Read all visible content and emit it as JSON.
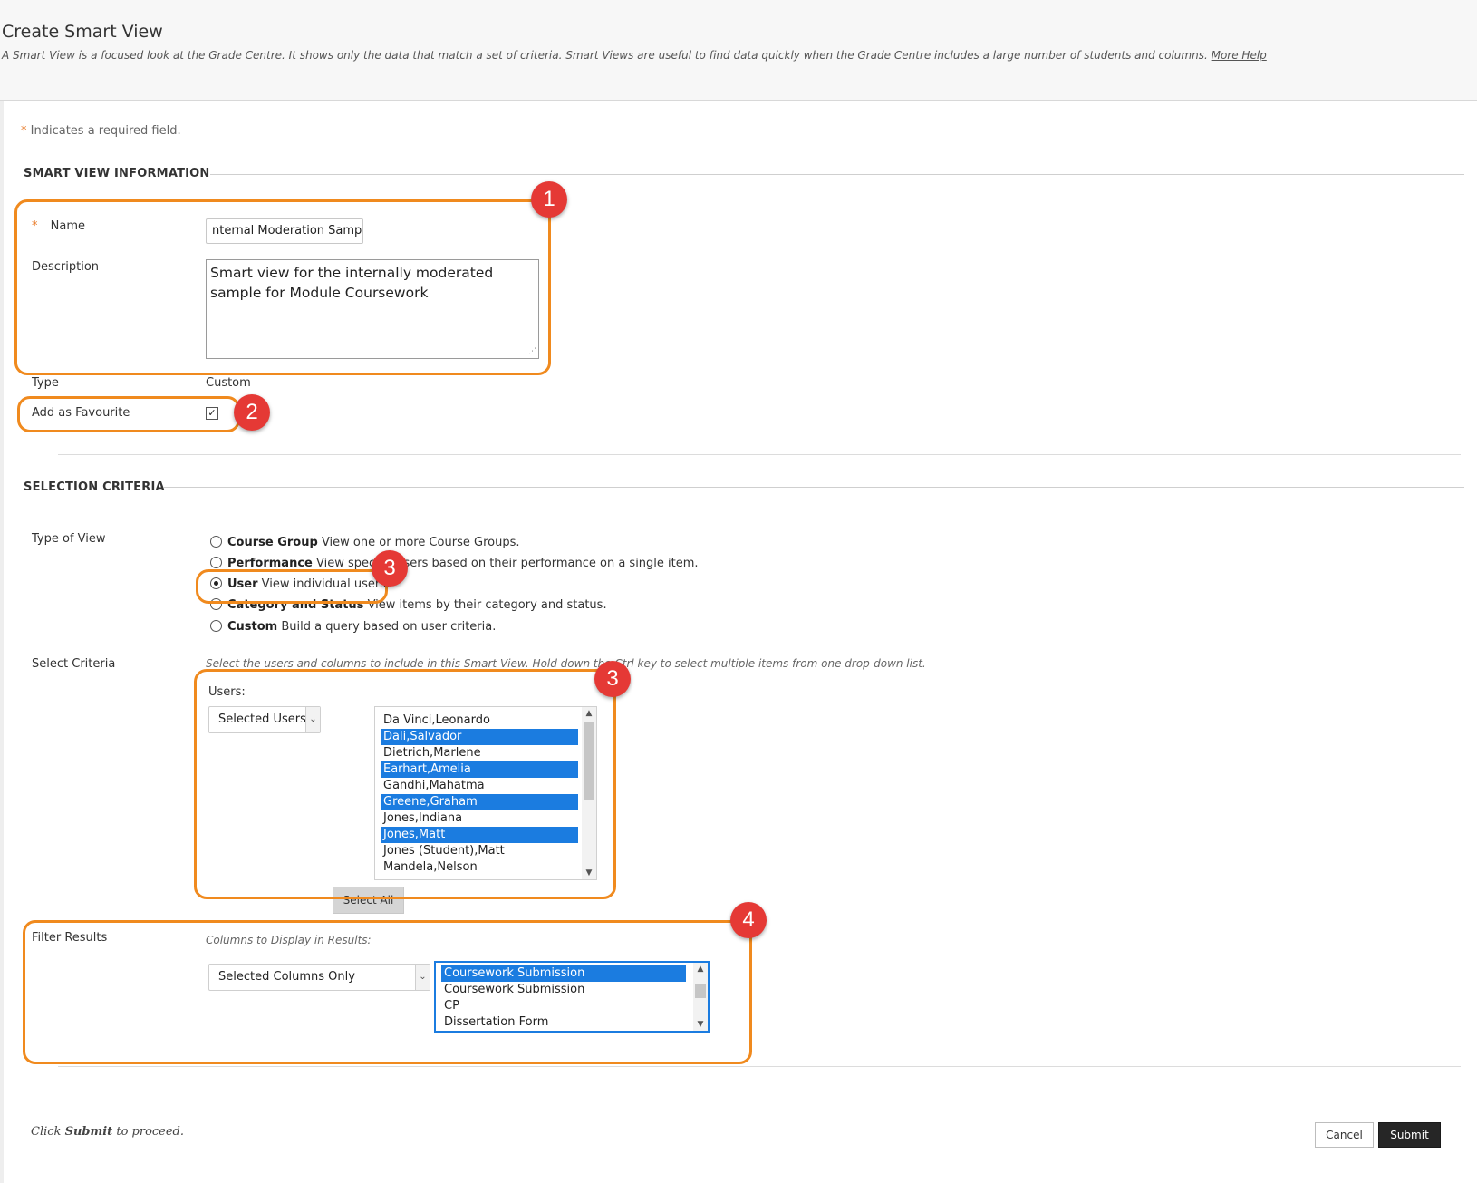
{
  "header": {
    "title": "Create Smart View",
    "instructions": "A Smart View is a focused look at the Grade Centre. It shows only the data that match a set of criteria. Smart Views are useful to find data quickly when the Grade Centre includes a large number of students and columns.",
    "more_help": "More Help"
  },
  "required_note": {
    "star": "*",
    "text": "Indicates a required field."
  },
  "smart_view_info": {
    "title": "SMART VIEW INFORMATION",
    "name_star": "*",
    "name_label": "Name",
    "name_value": "nternal Moderation Sample",
    "description_label": "Description",
    "description_value": "Smart view for the internally moderated sample for Module Coursework",
    "type_label": "Type",
    "type_value": "Custom",
    "favourite_label": "Add as Favourite",
    "favourite_checked": true,
    "favourite_check_glyph": "✓"
  },
  "selection_criteria": {
    "title": "SELECTION CRITERIA",
    "type_of_view_label": "Type of View",
    "view_options": [
      {
        "bold": "Course Group",
        "text": "View one or more Course Groups.",
        "checked": false
      },
      {
        "bold": "Performance",
        "text": "View specific users based on their performance on a single item.",
        "checked": false
      },
      {
        "bold": "User",
        "text": "View individual users.",
        "checked": true
      },
      {
        "bold": "Category and Status",
        "text": "View items by their category and status.",
        "checked": false
      },
      {
        "bold": "Custom",
        "text": "Build a query based on user criteria.",
        "checked": false
      }
    ],
    "select_criteria_label": "Select Criteria",
    "select_criteria_hint": "Select the users and columns to include in this Smart View. Hold down the Ctrl key to select multiple items from one drop-down list.",
    "users_label": "Users:",
    "users_filter_value": "Selected Users",
    "users_list": [
      {
        "name": "Da Vinci,Leonardo",
        "selected": false
      },
      {
        "name": "Dali,Salvador",
        "selected": true
      },
      {
        "name": "Dietrich,Marlene",
        "selected": false
      },
      {
        "name": "Earhart,Amelia",
        "selected": true
      },
      {
        "name": "Gandhi,Mahatma",
        "selected": false
      },
      {
        "name": "Greene,Graham",
        "selected": true
      },
      {
        "name": "Jones,Indiana",
        "selected": false
      },
      {
        "name": "Jones,Matt",
        "selected": true
      },
      {
        "name": "Jones (Student),Matt",
        "selected": false
      },
      {
        "name": "Mandela,Nelson",
        "selected": false
      }
    ],
    "select_all_label": "Select All",
    "filter_results_label": "Filter Results",
    "columns_hint": "Columns to Display in Results:",
    "columns_filter_value": "Selected Columns Only",
    "columns_list": [
      {
        "name": "Coursework Submission",
        "selected": true
      },
      {
        "name": "Coursework Submission",
        "selected": false
      },
      {
        "name": "CP",
        "selected": false
      },
      {
        "name": "Dissertation Form",
        "selected": false
      }
    ]
  },
  "callouts": {
    "m1": "1",
    "m2": "2",
    "m3a": "3",
    "m3b": "3",
    "m4": "4"
  },
  "footer": {
    "note_prefix": "Click",
    "note_bold": "Submit",
    "note_suffix": "to proceed.",
    "cancel_label": "Cancel",
    "submit_label": "Submit"
  },
  "colors": {
    "accent_orange": "#f08a1e",
    "marker_red": "#e53935",
    "selection_blue": "#1b7ce0",
    "submit_dark": "#262626"
  },
  "icons": {
    "select_arrow": "chevron-down-icon",
    "scroll_up": "chevron-up-icon",
    "scroll_down": "chevron-down-icon",
    "resize": "resize-grip-icon"
  }
}
